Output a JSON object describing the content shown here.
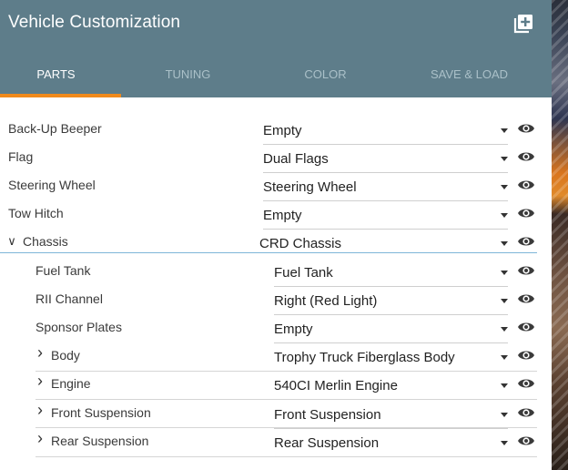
{
  "header": {
    "title": "Vehicle Customization"
  },
  "tabs": [
    {
      "label": "PARTS",
      "active": true
    },
    {
      "label": "TUNING",
      "active": false
    },
    {
      "label": "COLOR",
      "active": false
    },
    {
      "label": "SAVE & LOAD",
      "active": false
    }
  ],
  "parts": [
    {
      "label": "Back-Up Beeper",
      "value": "Empty",
      "level": 0,
      "expander": ""
    },
    {
      "label": "Flag",
      "value": "Dual Flags",
      "level": 0,
      "expander": ""
    },
    {
      "label": "Steering Wheel",
      "value": "Steering Wheel",
      "level": 0,
      "expander": ""
    },
    {
      "label": "Tow Hitch",
      "value": "Empty",
      "level": 0,
      "expander": ""
    },
    {
      "label": "Chassis",
      "value": "CRD Chassis",
      "level": 0,
      "expander": "expanded"
    },
    {
      "label": "Fuel Tank",
      "value": "Fuel Tank",
      "level": 1,
      "expander": ""
    },
    {
      "label": "RII Channel",
      "value": "Right (Red Light)",
      "level": 1,
      "expander": ""
    },
    {
      "label": "Sponsor Plates",
      "value": "Empty",
      "level": 1,
      "expander": ""
    },
    {
      "label": "Body",
      "value": "Trophy Truck Fiberglass Body",
      "level": 1,
      "expander": "collapsed"
    },
    {
      "label": "Engine",
      "value": "540CI Merlin Engine",
      "level": 1,
      "expander": "collapsed"
    },
    {
      "label": "Front Suspension",
      "value": "Front Suspension",
      "level": 1,
      "expander": "collapsed"
    },
    {
      "label": "Rear Suspension",
      "value": "Rear Suspension",
      "level": 1,
      "expander": "collapsed"
    }
  ],
  "icons": {
    "header_action": "add-box-icon",
    "row_visibility": "eye-icon",
    "dropdown": "caret-down-icon"
  },
  "colors": {
    "header": "#5e7d8a",
    "accent": "#f08a1c",
    "chassis_divider": "#7fb6d8"
  }
}
